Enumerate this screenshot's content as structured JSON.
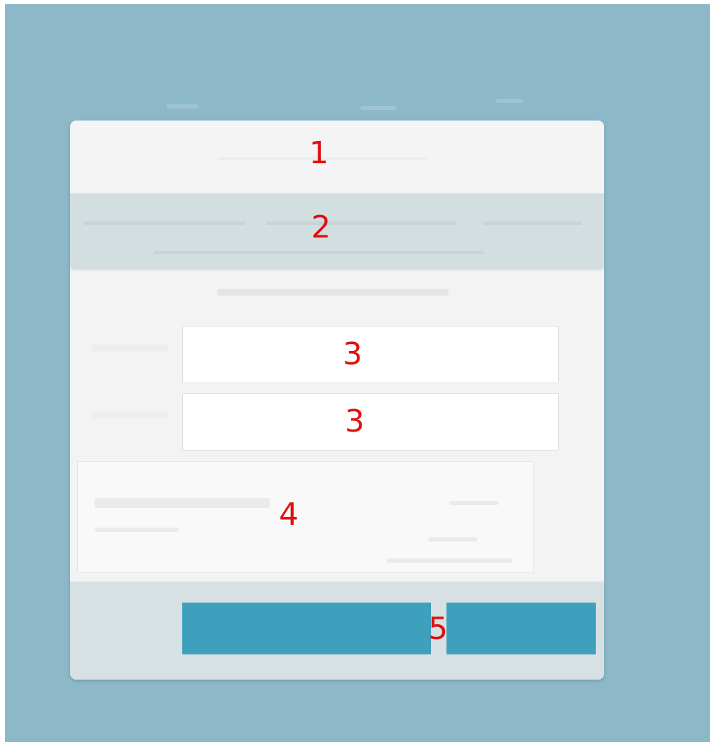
{
  "annotations": {
    "header": "1",
    "banner": "2",
    "field_one": "3",
    "field_two": "3",
    "notice": "4",
    "buttons": "5"
  },
  "dialog": {
    "field_one_value": "",
    "field_two_value": "",
    "primary_button_label": "",
    "secondary_button_label": ""
  }
}
